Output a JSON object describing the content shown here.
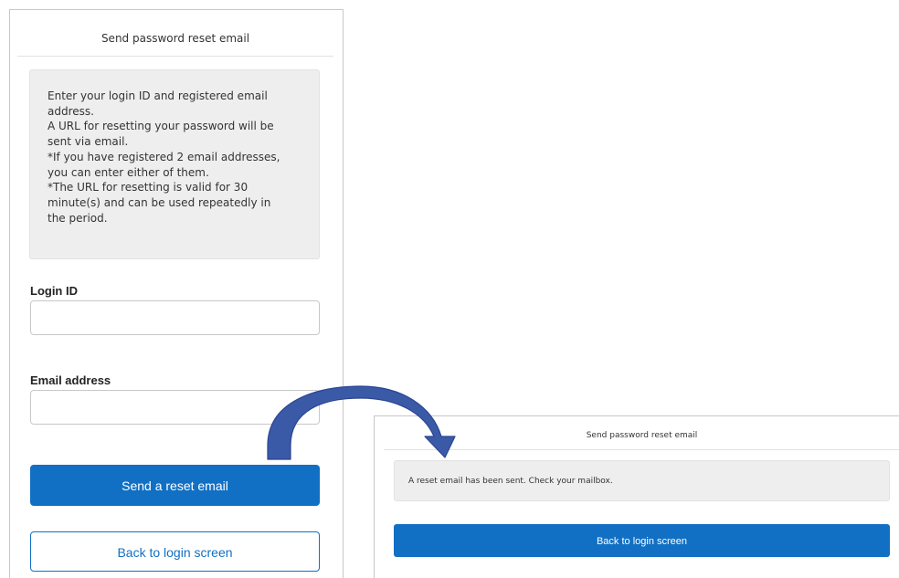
{
  "before": {
    "header_title": "Send password reset email",
    "instructions": [
      "Enter your login ID and registered email",
      "address.",
      "A URL for resetting your password will be",
      "sent via email.",
      "*If you have registered 2 email addresses,",
      "you can enter either of them.",
      "*The URL for resetting is valid for 30",
      "minute(s) and can be used repeatedly in",
      "the period."
    ],
    "login_id": {
      "label": "Login ID",
      "value": "",
      "placeholder": ""
    },
    "email": {
      "label": "Email address",
      "value": "",
      "placeholder": ""
    },
    "send_button_label": "Send a reset email",
    "back_button_label": "Back to login screen"
  },
  "after": {
    "header_title": "Send password reset email",
    "message": "A reset email has been sent. Check your mailbox.",
    "back_button_label": "Back to login screen"
  },
  "colors": {
    "primary": "#1170c4",
    "panel_bg": "#eeeeee",
    "arrow_fill": "#3a5aa8",
    "arrow_stroke": "#2a4590"
  },
  "icons": {
    "flow_arrow": "curved-arrow-icon"
  }
}
